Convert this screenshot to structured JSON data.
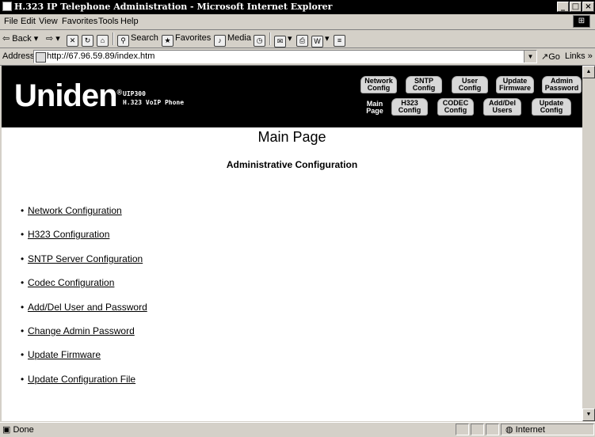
{
  "window": {
    "title": "H.323 IP Telephone Administration - Microsoft Internet Explorer",
    "min": "_",
    "max": "□",
    "close": "×"
  },
  "menu": [
    "File",
    "Edit",
    "View",
    "Favorites",
    "Tools",
    "Help"
  ],
  "toolbar": {
    "back": "Back",
    "search": "Search",
    "favorites": "Favorites",
    "media": "Media"
  },
  "address": {
    "label": "Address",
    "url": "http://67.96.59.89/index.htm",
    "go": "Go",
    "links": "Links »"
  },
  "banner": {
    "logo": "Uniden",
    "model_line1": "UIP300",
    "model_line2": "H.323 VoIP Phone",
    "nav_top": [
      "Network Config",
      "SNTP Config",
      "User Config",
      "Update Firmware",
      "Admin Password"
    ],
    "main_page": "Main Page",
    "nav_bottom": [
      "H323 Config",
      "CODEC Config",
      "Add/Del Users",
      "Update Config"
    ]
  },
  "content": {
    "heading": "Main Page",
    "subheading": "Administrative Configuration",
    "links": [
      "Network Configuration",
      "H323 Configuration",
      "SNTP Server Configuration",
      "Codec Configuration",
      "Add/Del User and Password",
      "Change Admin Password",
      "Update Firmware",
      "Update Configuration File"
    ]
  },
  "status": {
    "text": "Done",
    "zone": "Internet"
  }
}
